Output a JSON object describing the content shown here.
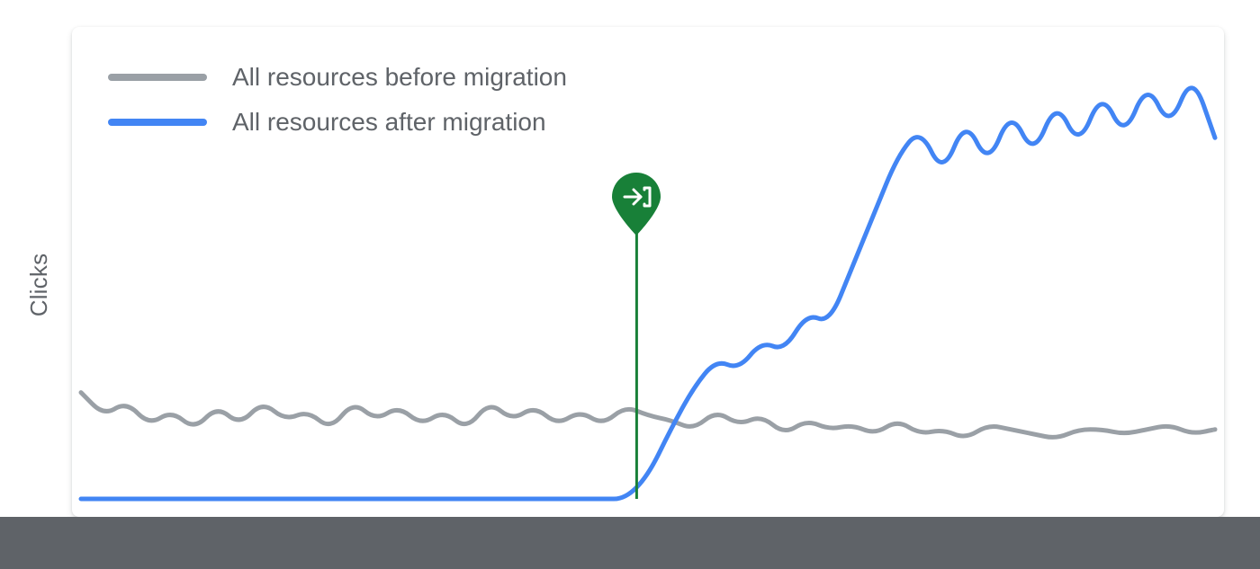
{
  "y_axis_label": "Clicks",
  "legend": {
    "before": "All resources before migration",
    "after": "All resources after migration"
  },
  "colors": {
    "before": "#9aa0a6",
    "after": "#4285f4",
    "marker_line": "#188038",
    "marker_fill": "#188038",
    "footer": "#5f6368"
  },
  "chart_data": {
    "type": "line",
    "title": "",
    "xlabel": "",
    "ylabel": "Clicks",
    "xlim": [
      0,
      100
    ],
    "ylim": [
      0,
      100
    ],
    "migration_x": 49,
    "annotations": [
      {
        "type": "vertical_line",
        "x": 49,
        "label": "migration",
        "color": "#188038"
      }
    ],
    "x": [
      0,
      2,
      4,
      6,
      8,
      10,
      12,
      14,
      16,
      18,
      20,
      22,
      24,
      26,
      28,
      30,
      32,
      34,
      36,
      38,
      40,
      42,
      44,
      46,
      48,
      50,
      52,
      54,
      56,
      58,
      60,
      62,
      64,
      66,
      68,
      70,
      72,
      74,
      76,
      78,
      80,
      82,
      84,
      86,
      88,
      90,
      92,
      94,
      96,
      98,
      100
    ],
    "series": [
      {
        "name": "All resources before migration",
        "color": "#9aa0a6",
        "values": [
          23,
          18,
          21,
          16,
          19,
          15,
          20,
          16,
          21,
          17,
          19,
          15,
          21,
          17,
          20,
          16,
          19,
          15,
          21,
          17,
          20,
          16,
          19,
          16,
          20,
          18,
          17,
          15,
          19,
          16,
          18,
          14,
          17,
          15,
          16,
          14,
          17,
          14,
          15,
          13,
          16,
          15,
          14,
          13,
          15,
          15,
          14,
          15,
          16,
          14,
          15
        ]
      },
      {
        "name": "All resources after migration",
        "color": "#4285f4",
        "values": [
          0,
          0,
          0,
          0,
          0,
          0,
          0,
          0,
          0,
          0,
          0,
          0,
          0,
          0,
          0,
          0,
          0,
          0,
          0,
          0,
          0,
          0,
          0,
          0,
          0,
          5,
          15,
          24,
          30,
          28,
          34,
          32,
          40,
          38,
          50,
          62,
          74,
          80,
          70,
          82,
          72,
          84,
          74,
          86,
          76,
          88,
          78,
          90,
          80,
          92,
          78
        ]
      }
    ]
  }
}
